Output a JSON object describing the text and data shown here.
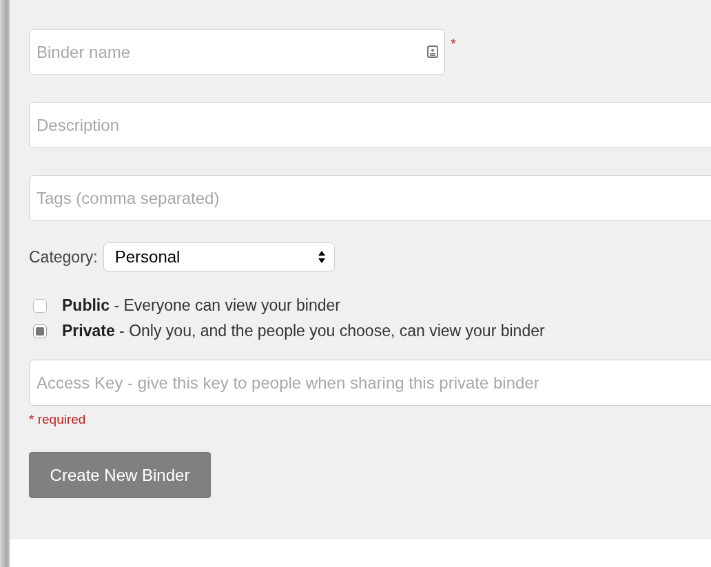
{
  "binder_name": {
    "placeholder": "Binder name",
    "required_mark": "*"
  },
  "description": {
    "placeholder": "Description"
  },
  "tags": {
    "placeholder": "Tags (comma separated)"
  },
  "category": {
    "label": "Category:",
    "value": "Personal"
  },
  "visibility": [
    {
      "title": "Public",
      "text": " - Everyone can view your binder",
      "selected": false
    },
    {
      "title": "Private",
      "text": " - Only you, and the people you choose, can view your binder",
      "selected": true
    }
  ],
  "access_key": {
    "placeholder": "Access Key - give this key to people when sharing this private binder"
  },
  "required_note": "* required",
  "submit": "Create New Binder"
}
